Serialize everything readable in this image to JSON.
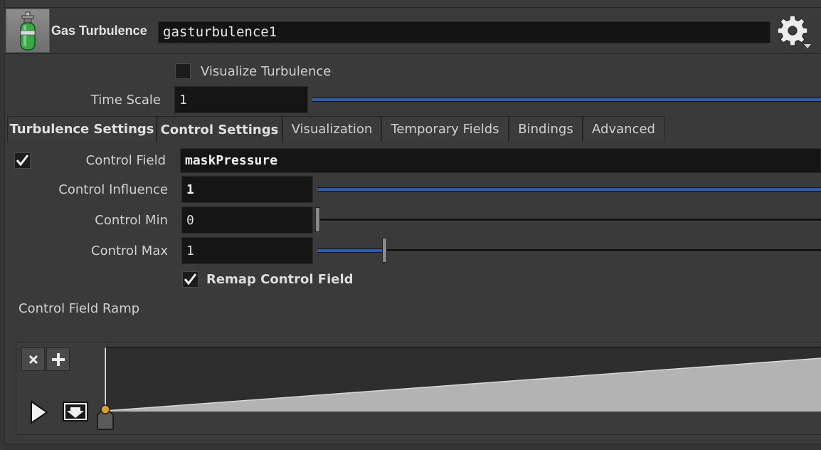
{
  "header": {
    "node_type": "Gas Turbulence",
    "node_name": "gasturbulence1",
    "icon": "gas-cylinder-icon",
    "settings_icon": "gear-icon"
  },
  "top_params": {
    "visualize_turbulence": {
      "label": "Visualize Turbulence",
      "checked": false
    },
    "time_scale": {
      "label": "Time Scale",
      "value": "1"
    }
  },
  "tabs": [
    {
      "label": "Turbulence Settings",
      "active": false
    },
    {
      "label": "Control Settings",
      "active": true
    },
    {
      "label": "Visualization",
      "active": false
    },
    {
      "label": "Temporary Fields",
      "active": false
    },
    {
      "label": "Bindings",
      "active": false
    },
    {
      "label": "Advanced",
      "active": false
    }
  ],
  "control": {
    "control_field": {
      "label": "Control Field",
      "value": "maskPressure",
      "enabled": true
    },
    "control_influence": {
      "label": "Control Influence",
      "value": "1"
    },
    "control_min": {
      "label": "Control Min",
      "value": "0"
    },
    "control_max": {
      "label": "Control Max",
      "value": "1"
    },
    "remap": {
      "label": "Remap Control Field",
      "checked": true
    }
  },
  "ramp": {
    "label": "Control Field Ramp",
    "delete_icon": "close-icon",
    "add_icon": "plus-icon",
    "play_icon": "play-icon",
    "menu_icon": "dropdown-arrow-icon",
    "key_icon": "ramp-key-icon"
  },
  "colors": {
    "accent_blue": "#2b5db3",
    "key_gold": "#d8a22c"
  }
}
